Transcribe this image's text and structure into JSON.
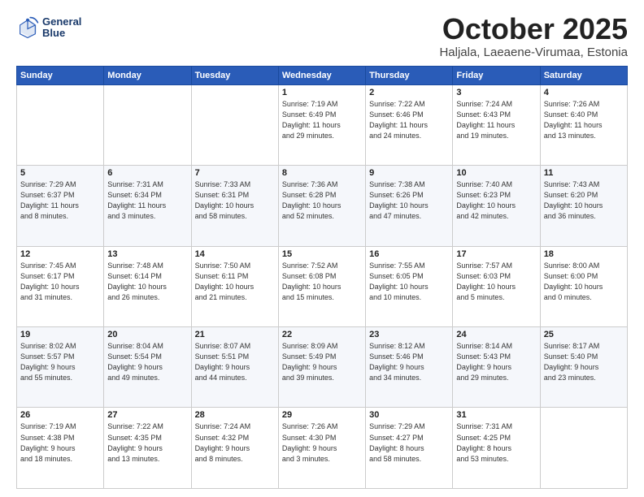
{
  "logo": {
    "line1": "General",
    "line2": "Blue"
  },
  "title": "October 2025",
  "subtitle": "Haljala, Laeaene-Virumaa, Estonia",
  "weekdays": [
    "Sunday",
    "Monday",
    "Tuesday",
    "Wednesday",
    "Thursday",
    "Friday",
    "Saturday"
  ],
  "weeks": [
    [
      {
        "day": "",
        "info": ""
      },
      {
        "day": "",
        "info": ""
      },
      {
        "day": "",
        "info": ""
      },
      {
        "day": "1",
        "info": "Sunrise: 7:19 AM\nSunset: 6:49 PM\nDaylight: 11 hours\nand 29 minutes."
      },
      {
        "day": "2",
        "info": "Sunrise: 7:22 AM\nSunset: 6:46 PM\nDaylight: 11 hours\nand 24 minutes."
      },
      {
        "day": "3",
        "info": "Sunrise: 7:24 AM\nSunset: 6:43 PM\nDaylight: 11 hours\nand 19 minutes."
      },
      {
        "day": "4",
        "info": "Sunrise: 7:26 AM\nSunset: 6:40 PM\nDaylight: 11 hours\nand 13 minutes."
      }
    ],
    [
      {
        "day": "5",
        "info": "Sunrise: 7:29 AM\nSunset: 6:37 PM\nDaylight: 11 hours\nand 8 minutes."
      },
      {
        "day": "6",
        "info": "Sunrise: 7:31 AM\nSunset: 6:34 PM\nDaylight: 11 hours\nand 3 minutes."
      },
      {
        "day": "7",
        "info": "Sunrise: 7:33 AM\nSunset: 6:31 PM\nDaylight: 10 hours\nand 58 minutes."
      },
      {
        "day": "8",
        "info": "Sunrise: 7:36 AM\nSunset: 6:28 PM\nDaylight: 10 hours\nand 52 minutes."
      },
      {
        "day": "9",
        "info": "Sunrise: 7:38 AM\nSunset: 6:26 PM\nDaylight: 10 hours\nand 47 minutes."
      },
      {
        "day": "10",
        "info": "Sunrise: 7:40 AM\nSunset: 6:23 PM\nDaylight: 10 hours\nand 42 minutes."
      },
      {
        "day": "11",
        "info": "Sunrise: 7:43 AM\nSunset: 6:20 PM\nDaylight: 10 hours\nand 36 minutes."
      }
    ],
    [
      {
        "day": "12",
        "info": "Sunrise: 7:45 AM\nSunset: 6:17 PM\nDaylight: 10 hours\nand 31 minutes."
      },
      {
        "day": "13",
        "info": "Sunrise: 7:48 AM\nSunset: 6:14 PM\nDaylight: 10 hours\nand 26 minutes."
      },
      {
        "day": "14",
        "info": "Sunrise: 7:50 AM\nSunset: 6:11 PM\nDaylight: 10 hours\nand 21 minutes."
      },
      {
        "day": "15",
        "info": "Sunrise: 7:52 AM\nSunset: 6:08 PM\nDaylight: 10 hours\nand 15 minutes."
      },
      {
        "day": "16",
        "info": "Sunrise: 7:55 AM\nSunset: 6:05 PM\nDaylight: 10 hours\nand 10 minutes."
      },
      {
        "day": "17",
        "info": "Sunrise: 7:57 AM\nSunset: 6:03 PM\nDaylight: 10 hours\nand 5 minutes."
      },
      {
        "day": "18",
        "info": "Sunrise: 8:00 AM\nSunset: 6:00 PM\nDaylight: 10 hours\nand 0 minutes."
      }
    ],
    [
      {
        "day": "19",
        "info": "Sunrise: 8:02 AM\nSunset: 5:57 PM\nDaylight: 9 hours\nand 55 minutes."
      },
      {
        "day": "20",
        "info": "Sunrise: 8:04 AM\nSunset: 5:54 PM\nDaylight: 9 hours\nand 49 minutes."
      },
      {
        "day": "21",
        "info": "Sunrise: 8:07 AM\nSunset: 5:51 PM\nDaylight: 9 hours\nand 44 minutes."
      },
      {
        "day": "22",
        "info": "Sunrise: 8:09 AM\nSunset: 5:49 PM\nDaylight: 9 hours\nand 39 minutes."
      },
      {
        "day": "23",
        "info": "Sunrise: 8:12 AM\nSunset: 5:46 PM\nDaylight: 9 hours\nand 34 minutes."
      },
      {
        "day": "24",
        "info": "Sunrise: 8:14 AM\nSunset: 5:43 PM\nDaylight: 9 hours\nand 29 minutes."
      },
      {
        "day": "25",
        "info": "Sunrise: 8:17 AM\nSunset: 5:40 PM\nDaylight: 9 hours\nand 23 minutes."
      }
    ],
    [
      {
        "day": "26",
        "info": "Sunrise: 7:19 AM\nSunset: 4:38 PM\nDaylight: 9 hours\nand 18 minutes."
      },
      {
        "day": "27",
        "info": "Sunrise: 7:22 AM\nSunset: 4:35 PM\nDaylight: 9 hours\nand 13 minutes."
      },
      {
        "day": "28",
        "info": "Sunrise: 7:24 AM\nSunset: 4:32 PM\nDaylight: 9 hours\nand 8 minutes."
      },
      {
        "day": "29",
        "info": "Sunrise: 7:26 AM\nSunset: 4:30 PM\nDaylight: 9 hours\nand 3 minutes."
      },
      {
        "day": "30",
        "info": "Sunrise: 7:29 AM\nSunset: 4:27 PM\nDaylight: 8 hours\nand 58 minutes."
      },
      {
        "day": "31",
        "info": "Sunrise: 7:31 AM\nSunset: 4:25 PM\nDaylight: 8 hours\nand 53 minutes."
      },
      {
        "day": "",
        "info": ""
      }
    ]
  ]
}
